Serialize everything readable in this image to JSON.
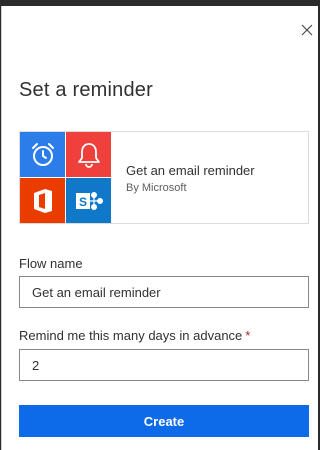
{
  "dialog": {
    "title": "Set a reminder",
    "close_icon": "close-icon"
  },
  "template_card": {
    "name": "Get an email reminder",
    "publisher": "By Microsoft",
    "tiles": [
      {
        "icon": "alarm-clock-icon",
        "color": "#2b7de9"
      },
      {
        "icon": "bell-icon",
        "color": "#f0403c"
      },
      {
        "icon": "office-icon",
        "color": "#eb3c00"
      },
      {
        "icon": "sharepoint-icon",
        "color": "#0f78c8"
      }
    ]
  },
  "form": {
    "flow_name_label": "Flow name",
    "flow_name_value": "Get an email reminder",
    "days_label": "Remind me this many days in advance",
    "days_required_mark": "*",
    "days_value": "2"
  },
  "actions": {
    "create_label": "Create",
    "create_color": "#0d6ae8"
  }
}
